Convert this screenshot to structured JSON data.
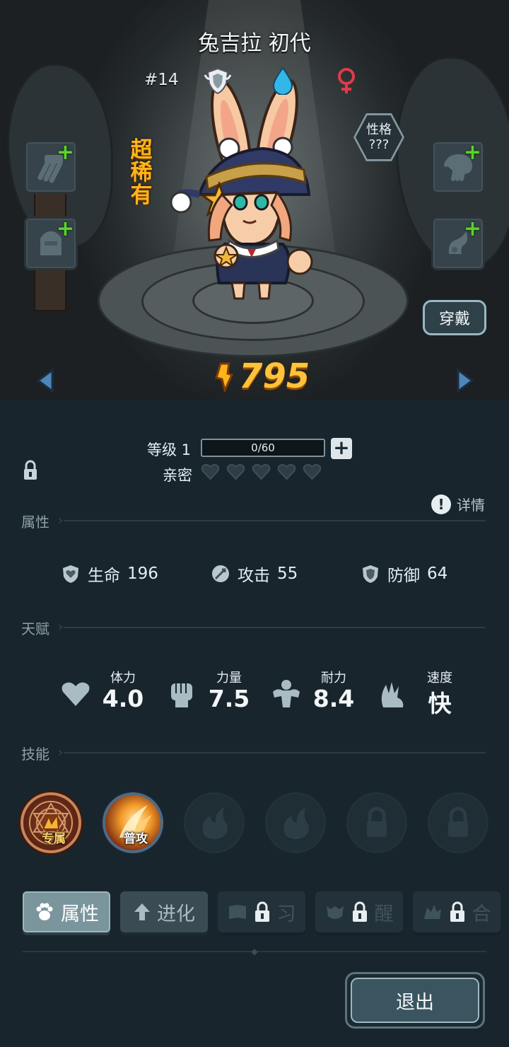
{
  "character": {
    "name": "兔吉拉 初代",
    "rank": "#14",
    "rarity": "超稀有",
    "personality": {
      "label": "性格",
      "value": "???"
    },
    "wear_button": "穿戴",
    "power": "795"
  },
  "level": {
    "label": "等级 1",
    "xp": "0/60"
  },
  "affinity": {
    "label": "亲密",
    "hearts": 5
  },
  "details_label": "详情",
  "sections": {
    "attributes": "属性",
    "talents": "天赋",
    "skills": "技能"
  },
  "stats": [
    {
      "label": "生命",
      "value": "196",
      "icon": "heart-shield-icon"
    },
    {
      "label": "攻击",
      "value": "55",
      "icon": "sword-icon"
    },
    {
      "label": "防御",
      "value": "64",
      "icon": "shield-icon"
    }
  ],
  "talents": [
    {
      "label": "体力",
      "value": "4.0",
      "icon": "heart-icon"
    },
    {
      "label": "力量",
      "value": "7.5",
      "icon": "fist-icon"
    },
    {
      "label": "耐力",
      "value": "8.4",
      "icon": "muscle-icon"
    },
    {
      "label": "速度",
      "value": "快",
      "icon": "wing-icon"
    }
  ],
  "skills": [
    {
      "tag": "专属",
      "state": "exclusive"
    },
    {
      "tag": "普攻",
      "state": "normal-attack"
    },
    {
      "tag": "",
      "state": "empty"
    },
    {
      "tag": "",
      "state": "empty"
    },
    {
      "tag": "",
      "state": "locked"
    },
    {
      "tag": "",
      "state": "locked"
    }
  ],
  "tabs": [
    {
      "label": "属性",
      "state": "active",
      "icon": "paw-icon"
    },
    {
      "label": "进化",
      "state": "normal",
      "icon": "arrow-up-icon"
    },
    {
      "label": "习",
      "state": "locked",
      "icon": "book-icon"
    },
    {
      "label": "醒",
      "state": "locked",
      "icon": "mask-icon"
    },
    {
      "label": "合",
      "state": "locked",
      "icon": "fusion-icon"
    }
  ],
  "exit_button": "退出",
  "colors": {
    "rarity": "#ffb41a",
    "power": "#ffc23a",
    "plus": "#5fd12c",
    "panel": "#19252c"
  }
}
